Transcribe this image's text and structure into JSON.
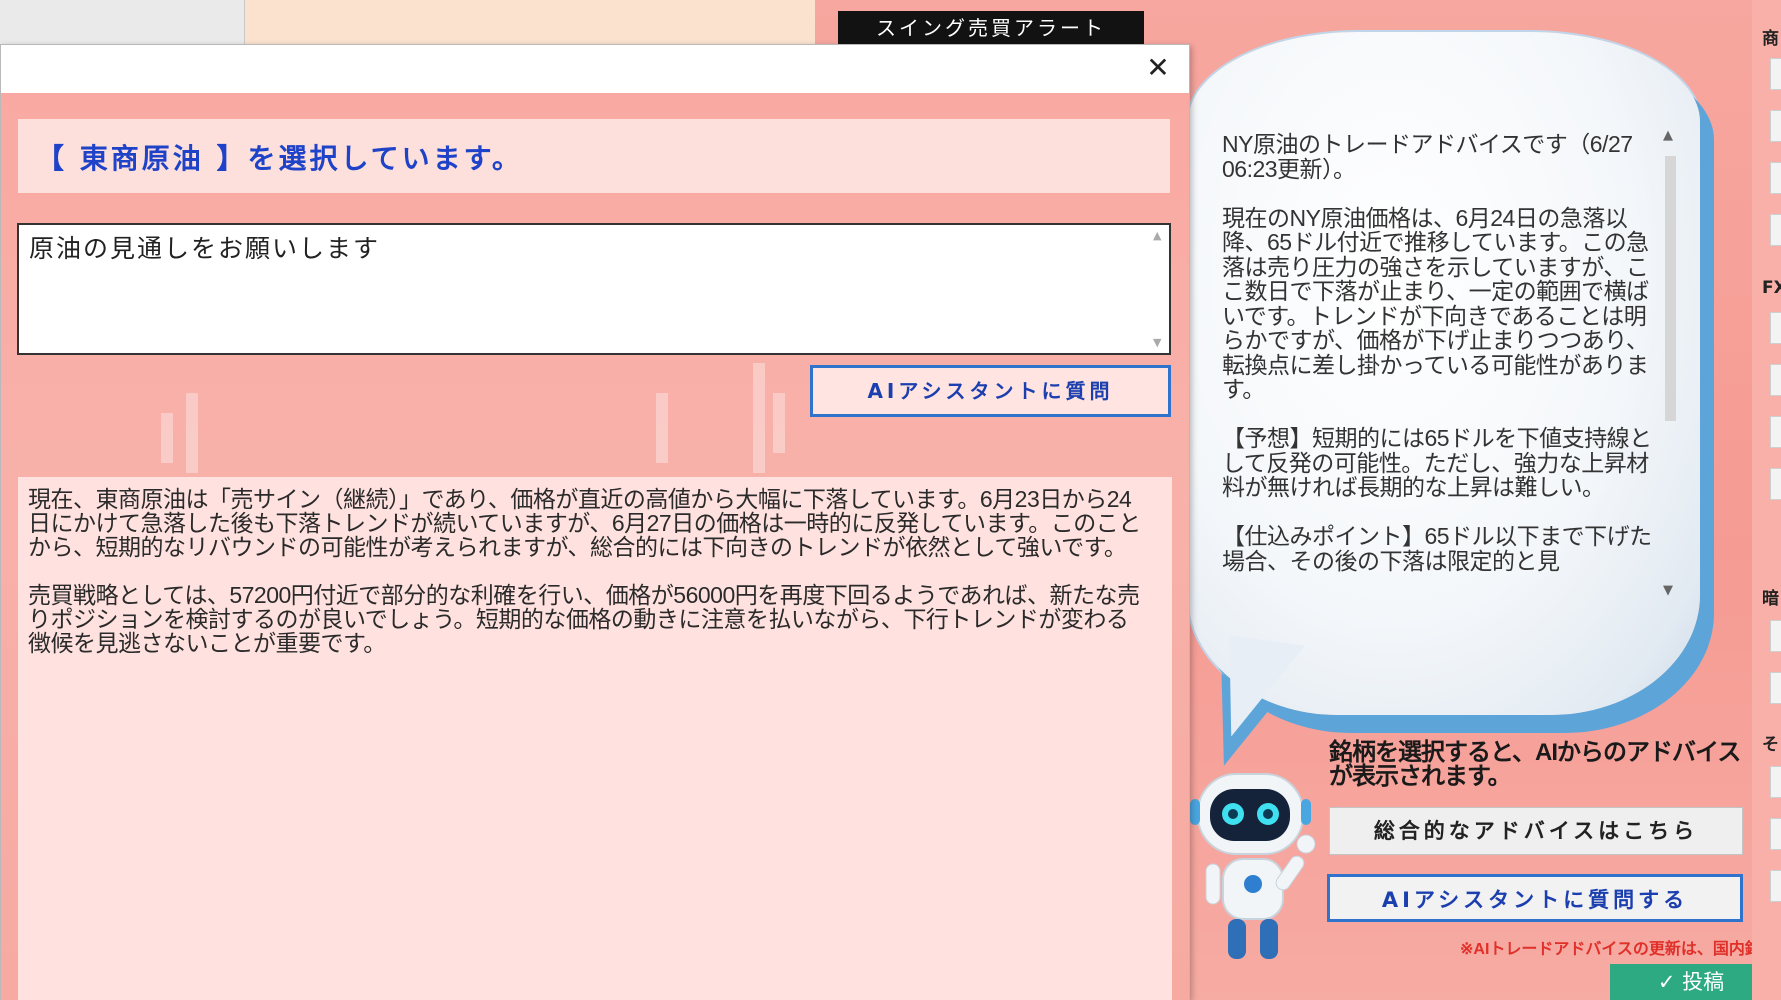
{
  "background_app": {
    "title": "スイング売買アラート",
    "advice_text": "NY原油のトレードアドバイスです（6/27 06:23更新）。\n\n現在のNY原油価格は、6月24日の急落以降、65ドル付近で推移しています。この急落は売り圧力の強さを示していますが、ここ数日で下落が止まり、一定の範囲で横ばいです。トレンドが下向きであることは明らかですが、価格が下げ止まりつつあり、転換点に差し掛かっている可能性があります。\n\n【予想】短期的には65ドルを下値支持線として反発の可能性。ただし、強力な上昇材料が無ければ長期的な上昇は難しい。\n\n【仕込みポイント】65ドル以下まで下げた場合、その後の下落は限定的と見",
    "robot_caption": "銘柄を選択すると、AIからのアドバイスが表示されます。",
    "overall_advice_label": "総合的なアドバイスはこちら",
    "ask_ai_label": "AIアシスタントに質問する",
    "note": "※AIトレードアドバイスの更新は、国内銘",
    "post_label": "投稿",
    "edge_labels": [
      "商",
      "FX",
      "暗",
      "そ"
    ]
  },
  "dialog": {
    "close_glyph": "✕",
    "selected_banner": "【 東商原油 】を選択しています。",
    "question_value": "原油の見通しをお願いします",
    "ask_button_label": "AIアシスタントに質問",
    "answer_text": "現在、東商原油は「売サイン（継続）」であり、価格が直近の高値から大幅に下落しています。6月23日から24日にかけて急落した後も下落トレンドが続いていますが、6月27日の価格は一時的に反発しています。このことから、短期的なリバウンドの可能性が考えられますが、総合的には下向きのトレンドが依然として強いです。\n\n売買戦略としては、57200円付近で部分的な利確を行い、価格が56000円を再度下回るようであれば、新たな売りポジションを検討するのが良いでしょう。短期的な価格の動きに注意を払いながら、下行トレンドが変わる徴候を見逃さないことが重要です。"
  },
  "colors": {
    "accent_blue": "#1f43c8",
    "button_border": "#2f73cc",
    "background_salmon": "#f8a8a0",
    "note_red": "#e0302a",
    "post_green": "#2daa82"
  }
}
